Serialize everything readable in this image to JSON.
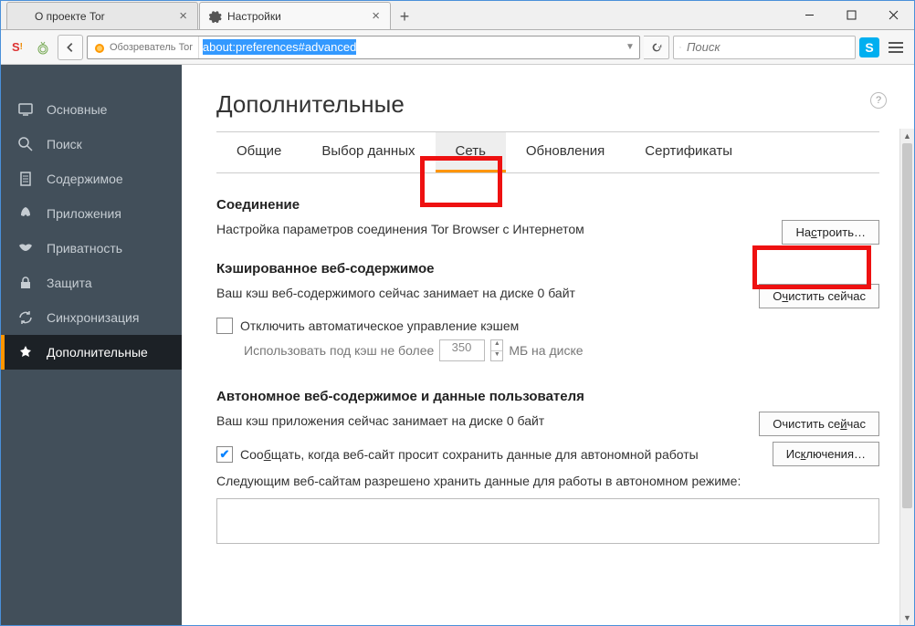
{
  "window_controls": {
    "min": "–",
    "max": "□",
    "close": "×"
  },
  "tabs": [
    {
      "label": "О проекте Tor",
      "active": false
    },
    {
      "label": "Настройки",
      "active": true
    }
  ],
  "toolbar": {
    "identity_label": "Обозреватель Tor",
    "url": "about:preferences#advanced",
    "search_placeholder": "Поиск"
  },
  "sidebar": {
    "items": [
      {
        "key": "general",
        "label": "Основные"
      },
      {
        "key": "search",
        "label": "Поиск"
      },
      {
        "key": "content",
        "label": "Содержимое"
      },
      {
        "key": "applications",
        "label": "Приложения"
      },
      {
        "key": "privacy",
        "label": "Приватность"
      },
      {
        "key": "security",
        "label": "Защита"
      },
      {
        "key": "sync",
        "label": "Синхронизация"
      },
      {
        "key": "advanced",
        "label": "Дополнительные",
        "active": true
      }
    ]
  },
  "page": {
    "title": "Дополнительные",
    "subtabs": [
      "Общие",
      "Выбор данных",
      "Сеть",
      "Обновления",
      "Сертификаты"
    ],
    "active_subtab": "Сеть",
    "connection": {
      "heading": "Соединение",
      "desc": "Настройка параметров соединения Tor Browser с Интернетом",
      "button": "Настроить…",
      "button_accel": "с"
    },
    "cache": {
      "heading": "Кэшированное веб-содержимое",
      "status": "Ваш кэш веб-содержимого сейчас занимает на диске 0 байт",
      "clear_btn": "Очистить сейчас",
      "clear_accel": "ч",
      "disable_label": "Отключить автоматическое управление кэшем",
      "limit_label": "Использовать под кэш не более",
      "limit_value": "350",
      "limit_unit": "МБ на диске"
    },
    "offline": {
      "heading": "Автономное веб-содержимое и данные пользователя",
      "status": "Ваш кэш приложения сейчас занимает на диске 0 байт",
      "clear_btn": "Очистить сейчас",
      "clear_accel": "й",
      "notify_label": "Сообщать, когда веб-сайт просит сохранить данные для автономной работы",
      "notify_accel": "б",
      "exceptions_btn": "Исключения…",
      "exceptions_accel": "к",
      "allowed_label": "Следующим веб-сайтам разрешено хранить данные для работы в автономном режиме:"
    }
  }
}
